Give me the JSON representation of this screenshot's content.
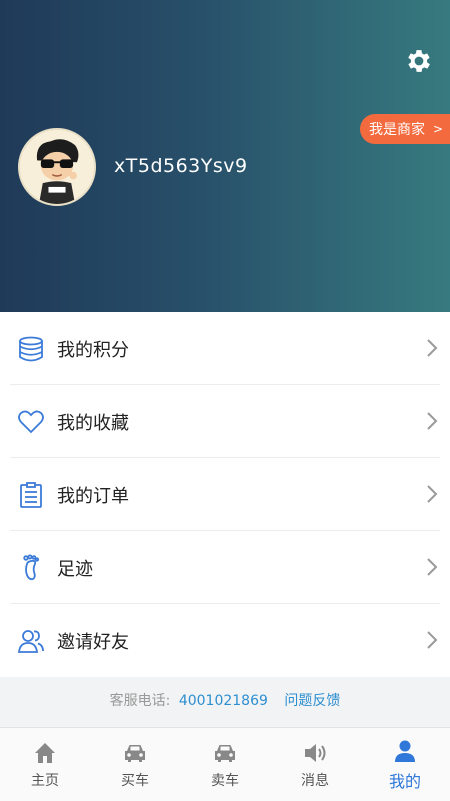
{
  "header": {
    "username": "xT5d563Ysv9",
    "merchant_label": "我是商家",
    "merchant_arrow": ">"
  },
  "menu": [
    {
      "label": "我的积分",
      "icon": "database-icon"
    },
    {
      "label": "我的收藏",
      "icon": "heart-icon"
    },
    {
      "label": "我的订单",
      "icon": "clipboard-icon"
    },
    {
      "label": "足迹",
      "icon": "footprint-icon"
    },
    {
      "label": "邀请好友",
      "icon": "users-icon"
    }
  ],
  "service": {
    "label": "客服电话:",
    "phone": "4001021869",
    "feedback": "问题反馈"
  },
  "tabs": [
    {
      "label": "主页",
      "icon": "home-icon",
      "active": false
    },
    {
      "label": "买车",
      "icon": "car-icon",
      "active": false
    },
    {
      "label": "卖车",
      "icon": "car-icon",
      "active": false
    },
    {
      "label": "消息",
      "icon": "speaker-icon",
      "active": false
    },
    {
      "label": "我的",
      "icon": "person-icon",
      "active": true
    }
  ],
  "colors": {
    "accent": "#2f77d9",
    "merchant_badge": "#f26a3e",
    "header_start": "#1f3a58",
    "header_end": "#377a7f"
  }
}
